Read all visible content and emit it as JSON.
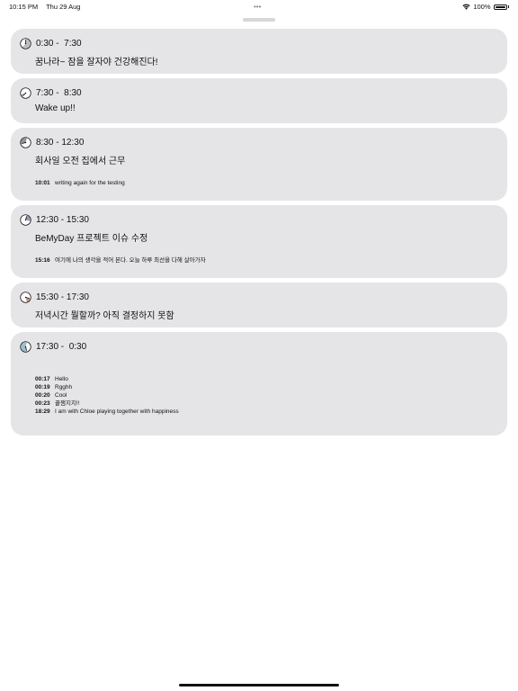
{
  "status_bar": {
    "time": "10:15 PM",
    "date": "Thu 29 Aug",
    "dots": "•••",
    "battery": "100%"
  },
  "schedule": [
    {
      "time_range": "0:30 -  7:30",
      "title": "꿈나라~ 잠을 잘자야 건강해진다!",
      "icon_color": "#888888",
      "memos": []
    },
    {
      "time_range": "7:30 -  8:30",
      "title": "Wake up!!",
      "icon_color": "#6a6a6a",
      "memos": []
    },
    {
      "time_range": "8:30 - 12:30",
      "title": "회사일 오전 집에서 근무",
      "icon_color": "#3a3a3a",
      "memos": [
        {
          "time": "10:01",
          "text": "writing again for the testing"
        }
      ]
    },
    {
      "time_range": "12:30 - 15:30",
      "title": "BeMyDay 프로젝트 이슈 수정",
      "icon_color": "#3a4a7a",
      "memos": [
        {
          "time": "15:16",
          "text": "여기에 나의 생각을 적어 본다. 오늘 하루 최선을 다해 살아가자"
        }
      ]
    },
    {
      "time_range": "15:30 - 17:30",
      "title": "저녁시간 뭘할까? 아직 결정하지 못함",
      "icon_color": "#a83a2a",
      "memos": []
    },
    {
      "time_range": "17:30 -  0:30",
      "title": "",
      "icon_color": "#4a8aa8",
      "memos": [
        {
          "time": "00:17",
          "text": "Hello"
        },
        {
          "time": "00:19",
          "text": "Rgghh"
        },
        {
          "time": "00:20",
          "text": "Cool"
        },
        {
          "time": "00:23",
          "text": "꿀잼지지!!"
        },
        {
          "time": "18:29",
          "text": "I am with Chloe playing together with happiness"
        }
      ]
    }
  ]
}
